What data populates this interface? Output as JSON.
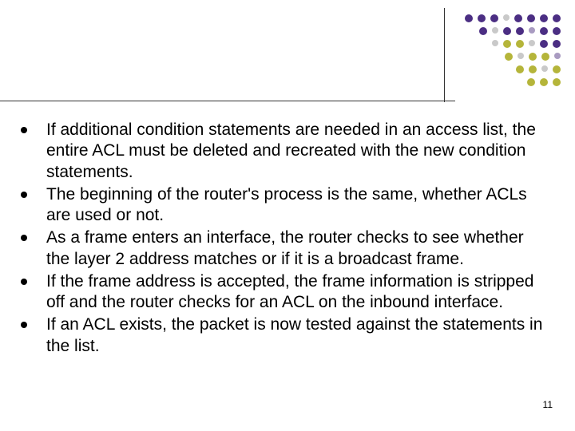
{
  "bullets": [
    "If additional condition statements are needed in an access list, the entire ACL must be deleted and recreated with the new condition statements.",
    "The beginning of the router's process is the same, whether ACLs are used or not.",
    "As a frame enters an interface, the router checks to see whether the layer 2 address matches or if it is a broadcast frame.",
    "If the frame address is accepted, the frame information is stripped off and the router checks for an ACL on the inbound interface.",
    "If an ACL exists, the packet is now tested against the statements in the list."
  ],
  "page_number": "11",
  "decoration": {
    "colors": {
      "purple": "#4b2e83",
      "olive": "#b5b53a",
      "gray": "#c9c9c9",
      "lightpurple": "#a99bc1"
    },
    "rows": [
      [
        {
          "c": "purple",
          "s": 10
        },
        {
          "c": "purple",
          "s": 10
        },
        {
          "c": "purple",
          "s": 10
        },
        {
          "c": "gray",
          "s": 8
        },
        {
          "c": "purple",
          "s": 10
        },
        {
          "c": "purple",
          "s": 10
        },
        {
          "c": "purple",
          "s": 10
        },
        {
          "c": "purple",
          "s": 10
        }
      ],
      [
        {
          "c": "purple",
          "s": 10
        },
        {
          "c": "gray",
          "s": 8
        },
        {
          "c": "purple",
          "s": 10
        },
        {
          "c": "purple",
          "s": 10
        },
        {
          "c": "lightpurple",
          "s": 8
        },
        {
          "c": "purple",
          "s": 10
        },
        {
          "c": "purple",
          "s": 10
        }
      ],
      [
        {
          "c": "gray",
          "s": 8
        },
        {
          "c": "olive",
          "s": 10
        },
        {
          "c": "olive",
          "s": 10
        },
        {
          "c": "gray",
          "s": 8
        },
        {
          "c": "purple",
          "s": 10
        },
        {
          "c": "purple",
          "s": 10
        }
      ],
      [
        {
          "c": "olive",
          "s": 10
        },
        {
          "c": "gray",
          "s": 8
        },
        {
          "c": "olive",
          "s": 10
        },
        {
          "c": "olive",
          "s": 10
        },
        {
          "c": "lightpurple",
          "s": 8
        }
      ],
      [
        {
          "c": "olive",
          "s": 10
        },
        {
          "c": "olive",
          "s": 10
        },
        {
          "c": "gray",
          "s": 8
        },
        {
          "c": "olive",
          "s": 10
        }
      ],
      [
        {
          "c": "olive",
          "s": 10
        },
        {
          "c": "olive",
          "s": 10
        },
        {
          "c": "olive",
          "s": 10
        }
      ]
    ]
  }
}
